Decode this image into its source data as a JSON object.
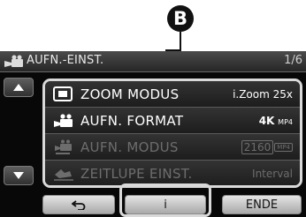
{
  "callout": {
    "letter": "B"
  },
  "header": {
    "title": "AUFN.-EINST.",
    "page": "1/6"
  },
  "scroll": {
    "up_icon": "triangle-up-icon",
    "down_icon": "triangle-down-icon"
  },
  "menu": {
    "items": [
      {
        "label": "ZOOM MODUS",
        "value": "i.Zoom 25x",
        "icon": "zoom-mode-icon",
        "enabled": true
      },
      {
        "label": "AUFN. FORMAT",
        "value": "4K",
        "badge": "MP4",
        "icon": "movie-camera-icon",
        "enabled": true
      },
      {
        "label": "AUFN. MODUS",
        "value": "2160",
        "badge": "MP4",
        "icon": "movie-mode-icon",
        "enabled": false
      },
      {
        "label": "ZEITLUPE EINST.",
        "value": "Interval",
        "icon": "slow-motion-icon",
        "enabled": false
      }
    ]
  },
  "footer": {
    "back_icon": "return-arrow-icon",
    "info_label": "i",
    "end_label": "ENDE"
  },
  "colors": {
    "screen_bg": "#080808",
    "highlight_border": "#d9d9d9",
    "button_bg": "#c8c8c8"
  }
}
